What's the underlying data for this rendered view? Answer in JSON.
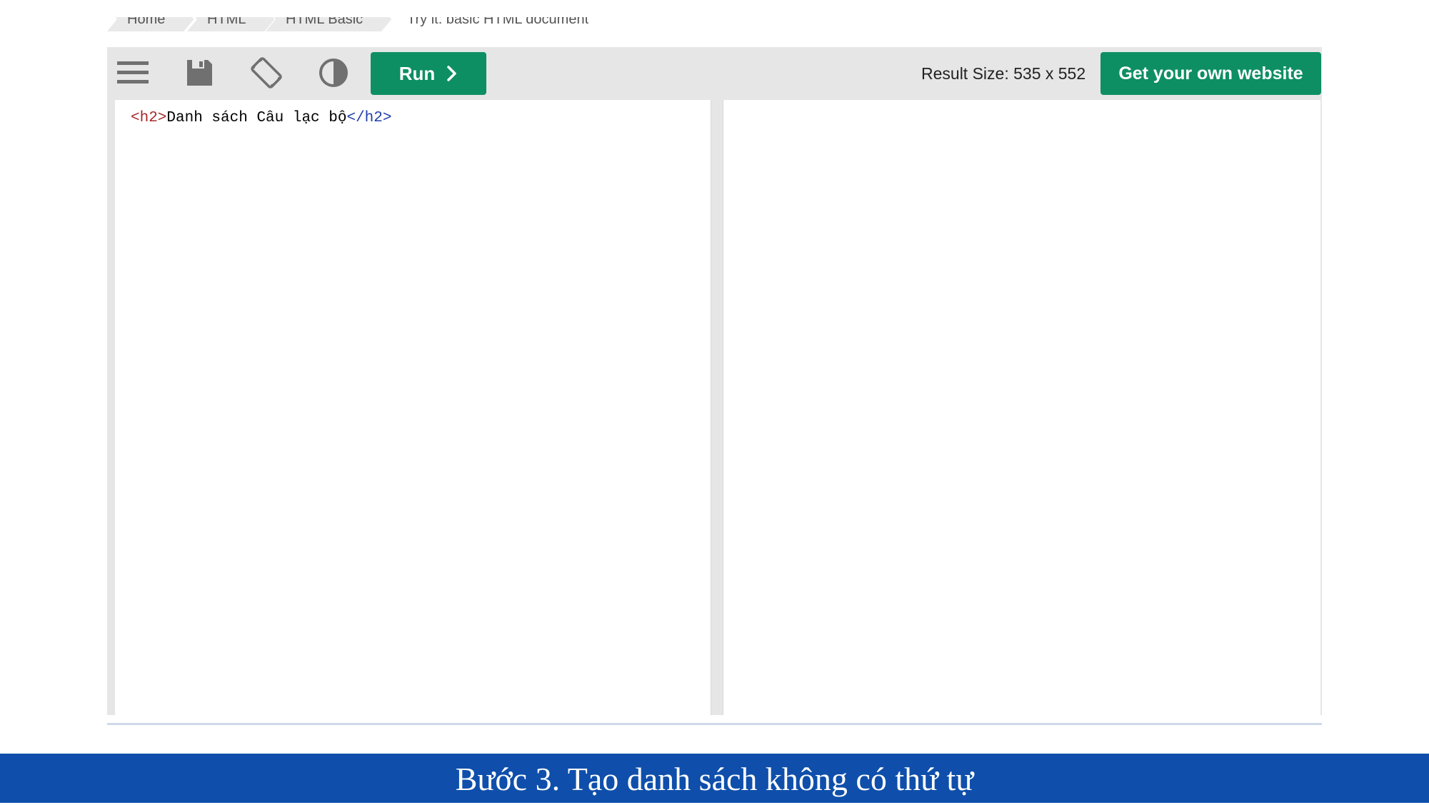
{
  "breadcrumb": {
    "items": [
      "Home",
      "HTML",
      "HTML Basic",
      "Try it: basic HTML document"
    ]
  },
  "toolbar": {
    "menu_icon": "hamburger-menu-icon",
    "save_icon": "floppy-disk-save-icon",
    "rotate_icon": "rotate-orientation-icon",
    "theme_icon": "contrast-theme-icon",
    "run_label": "Run",
    "run_icon": "chevron-right-icon",
    "result_size_label": "Result Size: 535 x 552",
    "own_site_label": "Get your own website"
  },
  "editor": {
    "open_tag": "<h2>",
    "text": "Danh sách Câu lạc bộ",
    "close_tag": "</h2>"
  },
  "caption": {
    "text": "Bước 3. Tạo danh sách không có thứ tự"
  },
  "colors": {
    "accent_green": "#0e8f63",
    "caption_blue": "#0f4fab",
    "toolbar_gray": "#e6e6e6"
  }
}
